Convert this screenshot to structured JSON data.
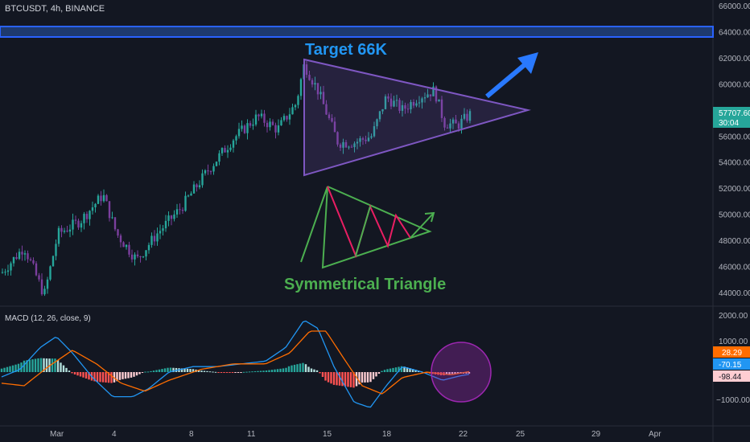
{
  "header": {
    "symbol": "BTCUSDT, 4h, BINANCE"
  },
  "annotations": {
    "target": "Target 66K",
    "pattern": "Symmetrical Triangle"
  },
  "price_axis": {
    "ticks": [
      "66000.00",
      "64000.00",
      "62000.00",
      "60000.00",
      "58000.00",
      "56000.00",
      "54000.00",
      "52000.00",
      "50000.00",
      "48000.00",
      "46000.00",
      "44000.00"
    ],
    "current_price": "57707.60",
    "countdown": "30:04"
  },
  "macd_panel": {
    "title": "MACD (12, 26, close, 9)",
    "axis_ticks": [
      "2000.00",
      "1000.00",
      "−1000.00"
    ],
    "values": [
      "28.29",
      "-70.15",
      "-98.44"
    ]
  },
  "time_axis": {
    "labels": [
      "Mar",
      "4",
      "8",
      "11",
      "15",
      "18",
      "22",
      "25",
      "29",
      "Apr"
    ]
  },
  "colors": {
    "background": "#131722",
    "bull": "#26a69a",
    "bear": "#7b3f9e",
    "triangle": "#7e57c2",
    "arrow": "#2979ff",
    "pattern": "#4caf50",
    "pattern_inner": "#e91e63",
    "macd": "#2196f3",
    "signal": "#ff6d00",
    "resistance_band": "#2962ff"
  },
  "chart_data": {
    "type": "candlestick",
    "title": "BTCUSDT, 4h, BINANCE",
    "ylim": [
      43000,
      66500
    ],
    "resistance_zone": [
      63600,
      64500
    ],
    "approx_close_path": [
      {
        "x": "Feb 27",
        "y": 45500
      },
      {
        "x": "Feb 28",
        "y": 44000
      },
      {
        "x": "Mar 1",
        "y": 48500
      },
      {
        "x": "Mar 3",
        "y": 50500
      },
      {
        "x": "Mar 4",
        "y": 48500
      },
      {
        "x": "Mar 6",
        "y": 48000
      },
      {
        "x": "Mar 8",
        "y": 50500
      },
      {
        "x": "Mar 9",
        "y": 53000
      },
      {
        "x": "Mar 10",
        "y": 55500
      },
      {
        "x": "Mar 11",
        "y": 57000
      },
      {
        "x": "Mar 13",
        "y": 61500
      },
      {
        "x": "Mar 15",
        "y": 56000
      },
      {
        "x": "Mar 16",
        "y": 55000
      },
      {
        "x": "Mar 17",
        "y": 58500
      },
      {
        "x": "Mar 18",
        "y": 58500
      },
      {
        "x": "Mar 20",
        "y": 59000
      },
      {
        "x": "Mar 21",
        "y": 56500
      },
      {
        "x": "Mar 22",
        "y": 57700
      }
    ],
    "triangle": {
      "upper": [
        {
          "x": "Mar 13",
          "y": 61800
        },
        {
          "x": "Mar 26",
          "y": 58000
        }
      ],
      "lower": [
        {
          "x": "Mar 13",
          "y": 53000
        },
        {
          "x": "Mar 26",
          "y": 58000
        }
      ]
    },
    "macd": {
      "macd": -70.15,
      "signal": 28.29,
      "histogram": -98.44
    }
  }
}
